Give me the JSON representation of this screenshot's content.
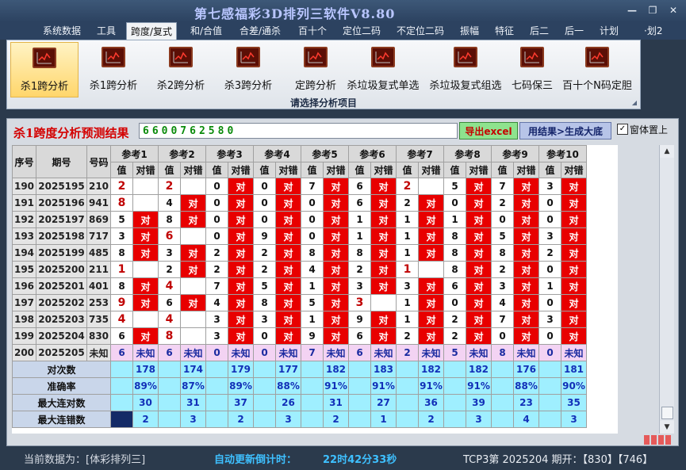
{
  "window": {
    "title": "第七感福彩3D排列三软件V8.80",
    "minimize": "—",
    "restore": "❐",
    "close": "✕"
  },
  "menu": [
    {
      "label": "系统数据"
    },
    {
      "label": "工具"
    },
    {
      "label": "跨度/复式",
      "active": true
    },
    {
      "label": "和/合值"
    },
    {
      "label": "合差/通杀"
    },
    {
      "label": "百十个"
    },
    {
      "label": "定位二码"
    },
    {
      "label": "不定位二码"
    },
    {
      "label": "振幅"
    },
    {
      "label": "特征"
    },
    {
      "label": "后二"
    },
    {
      "label": "后一"
    },
    {
      "label": "计划"
    },
    {
      "label": "·划2"
    }
  ],
  "ribbon": {
    "buttons": [
      {
        "label": "杀1跨分析",
        "active": true
      },
      {
        "label": "杀1跨分析"
      },
      {
        "label": "杀2跨分析"
      },
      {
        "label": "杀3跨分析"
      },
      {
        "label": "定跨分析"
      },
      {
        "label": "杀垃圾复式单选"
      },
      {
        "label": "杀垃圾复式组选"
      },
      {
        "label": "七码保三"
      },
      {
        "label": "百十个N码定胆"
      }
    ],
    "caption": "请选择分析项目"
  },
  "result": {
    "title": "杀1跨度分析预测结果",
    "value": "6600762580",
    "export_label": "导出excel",
    "generate_label": "用结果>生成大底",
    "pin_label": "窗体置上",
    "pin_checked": "✓"
  },
  "table": {
    "col_seq": "序号",
    "col_issue": "期号",
    "col_code": "号码",
    "refs": [
      "参考1",
      "参考2",
      "参考3",
      "参考4",
      "参考5",
      "参考6",
      "参考7",
      "参考8",
      "参考9",
      "参考10"
    ],
    "sub_value": "值",
    "sub_hit": "对错",
    "hit_mark": "对",
    "rows": [
      {
        "seq": "190",
        "issue": "2025195",
        "code": "210",
        "vals": [
          "2",
          "2",
          "0",
          "0",
          "7",
          "6",
          "2",
          "5",
          "7",
          "3"
        ],
        "hits": [
          false,
          false,
          true,
          true,
          true,
          true,
          false,
          true,
          true,
          true
        ]
      },
      {
        "seq": "191",
        "issue": "2025196",
        "code": "941",
        "vals": [
          "8",
          "4",
          "0",
          "0",
          "0",
          "6",
          "2",
          "0",
          "2",
          "0"
        ],
        "hits": [
          false,
          true,
          true,
          true,
          true,
          true,
          true,
          true,
          true,
          true
        ]
      },
      {
        "seq": "192",
        "issue": "2025197",
        "code": "869",
        "vals": [
          "5",
          "8",
          "0",
          "0",
          "0",
          "1",
          "1",
          "1",
          "0",
          "0"
        ],
        "hits": [
          true,
          true,
          true,
          true,
          true,
          true,
          true,
          true,
          true,
          true
        ]
      },
      {
        "seq": "193",
        "issue": "2025198",
        "code": "717",
        "vals": [
          "3",
          "6",
          "0",
          "9",
          "0",
          "1",
          "1",
          "8",
          "5",
          "3"
        ],
        "hits": [
          true,
          false,
          true,
          true,
          true,
          true,
          true,
          true,
          true,
          true
        ]
      },
      {
        "seq": "194",
        "issue": "2025199",
        "code": "485",
        "vals": [
          "8",
          "3",
          "2",
          "2",
          "8",
          "8",
          "1",
          "8",
          "8",
          "2"
        ],
        "hits": [
          true,
          true,
          true,
          true,
          true,
          true,
          true,
          true,
          true,
          true
        ]
      },
      {
        "seq": "195",
        "issue": "2025200",
        "code": "211",
        "vals": [
          "1",
          "2",
          "2",
          "2",
          "4",
          "2",
          "1",
          "8",
          "2",
          "0"
        ],
        "hits": [
          false,
          true,
          true,
          true,
          true,
          true,
          false,
          true,
          true,
          true
        ]
      },
      {
        "seq": "196",
        "issue": "2025201",
        "code": "401",
        "vals": [
          "8",
          "4",
          "7",
          "5",
          "1",
          "3",
          "3",
          "6",
          "3",
          "1"
        ],
        "hits": [
          true,
          false,
          true,
          true,
          true,
          true,
          true,
          true,
          true,
          true
        ]
      },
      {
        "seq": "197",
        "issue": "2025202",
        "code": "253",
        "vals": [
          "9",
          "6",
          "4",
          "8",
          "5",
          "3",
          "1",
          "0",
          "4",
          "0"
        ],
        "hits": [
          true,
          true,
          true,
          true,
          true,
          false,
          true,
          true,
          true,
          true
        ]
      },
      {
        "seq": "198",
        "issue": "2025203",
        "code": "735",
        "vals": [
          "4",
          "4",
          "3",
          "3",
          "1",
          "9",
          "1",
          "2",
          "7",
          "3"
        ],
        "hits": [
          false,
          false,
          true,
          true,
          true,
          true,
          true,
          true,
          true,
          true
        ]
      },
      {
        "seq": "199",
        "issue": "2025204",
        "code": "830",
        "vals": [
          "6",
          "8",
          "3",
          "0",
          "9",
          "6",
          "2",
          "2",
          "0",
          "0"
        ],
        "hits": [
          true,
          false,
          true,
          true,
          true,
          true,
          true,
          true,
          true,
          true
        ]
      }
    ],
    "red_values": [
      [
        0,
        1,
        6
      ],
      [
        0
      ],
      [],
      [
        1
      ],
      [],
      [
        0,
        6
      ],
      [
        1
      ],
      [
        0,
        5
      ],
      [
        0,
        1
      ],
      [
        1
      ]
    ],
    "unknown_row": {
      "seq": "200",
      "issue": "2025205",
      "code": "未知",
      "vals": [
        "6",
        "6",
        "0",
        "0",
        "7",
        "6",
        "2",
        "5",
        "8",
        "0"
      ],
      "hit_text": "未知"
    },
    "stats": [
      {
        "label": "对次数",
        "values": [
          "178",
          "174",
          "179",
          "177",
          "182",
          "183",
          "182",
          "182",
          "176",
          "181"
        ]
      },
      {
        "label": "准确率",
        "values": [
          "89%",
          "87%",
          "89%",
          "88%",
          "91%",
          "91%",
          "91%",
          "91%",
          "88%",
          "90%"
        ]
      },
      {
        "label": "最大连对数",
        "values": [
          "30",
          "31",
          "37",
          "26",
          "31",
          "27",
          "36",
          "39",
          "23",
          "35"
        ]
      },
      {
        "label": "最大连错数",
        "values": [
          "2",
          "3",
          "2",
          "3",
          "2",
          "1",
          "2",
          "3",
          "4",
          "3"
        ]
      }
    ]
  },
  "status": {
    "current_label": "当前数据为：[体彩排列三]",
    "countdown_label": "自动更新倒计时：",
    "countdown_value": "22时42分33秒",
    "issue_info": "TCP3第 2025204 期开：【830】【746】"
  }
}
